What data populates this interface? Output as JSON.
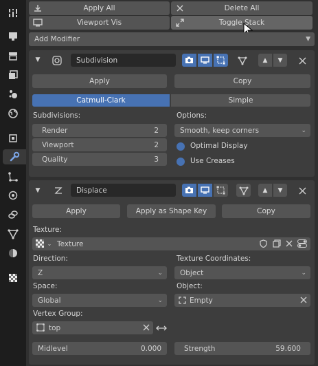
{
  "toolbar": {
    "apply_all": "Apply All",
    "delete_all": "Delete All",
    "viewport_vis": "Viewport Vis",
    "toggle_stack": "Toggle Stack",
    "add_modifier": "Add Modifier"
  },
  "subdivision": {
    "name": "Subdivision",
    "apply": "Apply",
    "copy": "Copy",
    "tab_catmull": "Catmull-Clark",
    "tab_simple": "Simple",
    "subdivisions_label": "Subdivisions:",
    "render_label": "Render",
    "render_value": "2",
    "viewport_label": "Viewport",
    "viewport_value": "2",
    "quality_label": "Quality",
    "quality_value": "3",
    "options_label": "Options:",
    "uv_smooth": "Smooth, keep corners",
    "optimal_display": "Optimal Display",
    "use_creases": "Use Creases"
  },
  "displace": {
    "name": "Displace",
    "apply": "Apply",
    "apply_shape_key": "Apply as Shape Key",
    "copy": "Copy",
    "texture_label": "Texture:",
    "texture_value": "Texture",
    "direction_label": "Direction:",
    "direction_value": "Z",
    "texcoords_label": "Texture Coordinates:",
    "texcoords_value": "Object",
    "space_label": "Space:",
    "space_value": "Global",
    "object_label": "Object:",
    "object_value": "Empty",
    "vgroup_label": "Vertex Group:",
    "vgroup_value": "top",
    "midlevel_label": "Midlevel",
    "midlevel_value": "0.000",
    "strength_label": "Strength",
    "strength_value": "59.600"
  },
  "colors": {
    "accent": "#4772b3",
    "panel": "#303030",
    "card": "#3d3d3d",
    "button": "#545454"
  }
}
